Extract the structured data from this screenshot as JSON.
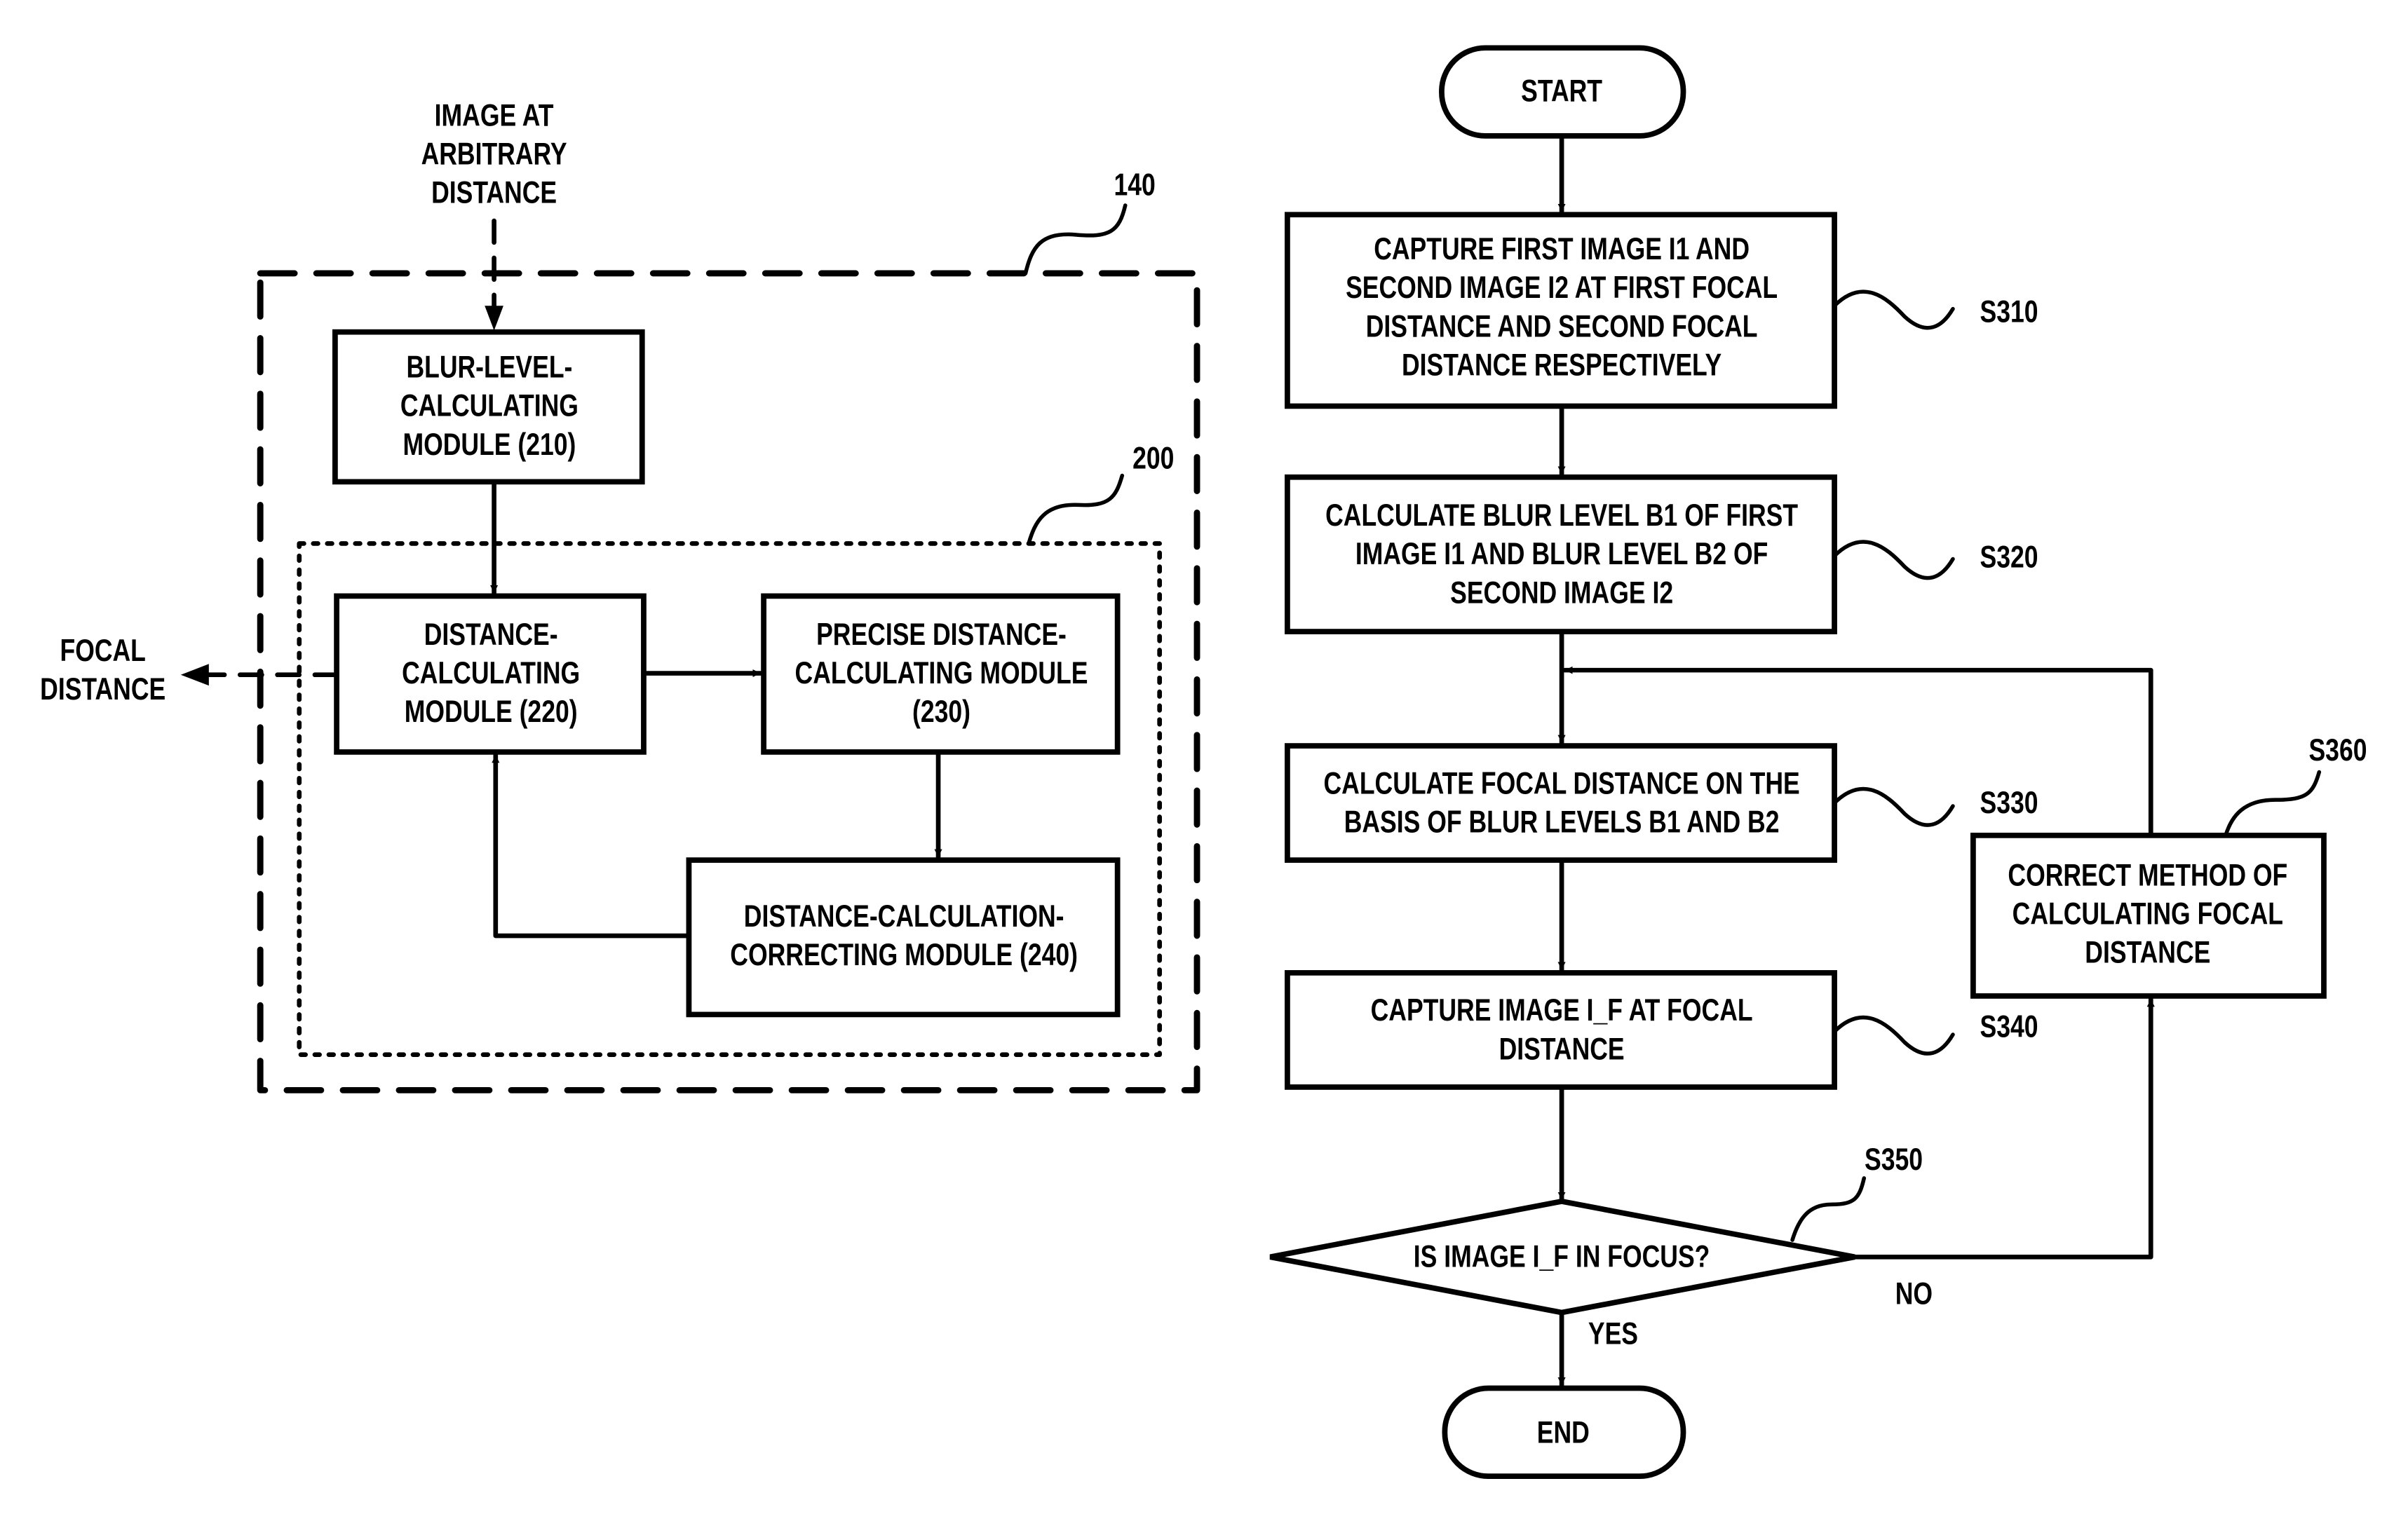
{
  "figure": {
    "left_diagram": {
      "input_label": [
        "IMAGE AT",
        "ARBITRARY",
        "DISTANCE"
      ],
      "output_label": [
        "FOCAL",
        "DISTANCE"
      ],
      "outer_ref": "140",
      "inner_ref": "200",
      "modules": [
        {
          "id": "210",
          "lines": [
            "BLUR-LEVEL-",
            "CALCULATING",
            "MODULE (210)"
          ]
        },
        {
          "id": "220",
          "lines": [
            "DISTANCE-",
            "CALCULATING",
            "MODULE (220)"
          ]
        },
        {
          "id": "230",
          "lines": [
            "PRECISE DISTANCE-",
            "CALCULATING MODULE",
            "(230)"
          ]
        },
        {
          "id": "240",
          "lines": [
            "DISTANCE-CALCULATION-",
            "CORRECTING MODULE (240)"
          ]
        }
      ]
    },
    "flowchart": {
      "start": "START",
      "end": "END",
      "steps": [
        {
          "ref": "S310",
          "lines": [
            "CAPTURE FIRST IMAGE I1 AND",
            "SECOND IMAGE I2 AT FIRST FOCAL",
            "DISTANCE AND SECOND FOCAL",
            "DISTANCE RESPECTIVELY"
          ]
        },
        {
          "ref": "S320",
          "lines": [
            "CALCULATE BLUR LEVEL B1 OF FIRST",
            "IMAGE I1 AND BLUR LEVEL B2 OF",
            "SECOND IMAGE I2"
          ]
        },
        {
          "ref": "S330",
          "lines": [
            "CALCULATE FOCAL DISTANCE ON THE",
            "BASIS OF BLUR LEVELS B1 AND B2"
          ]
        },
        {
          "ref": "S340",
          "lines": [
            "CAPTURE IMAGE I_F AT FOCAL",
            "DISTANCE"
          ]
        }
      ],
      "decision": {
        "ref": "S350",
        "text": "IS IMAGE I_F IN FOCUS?",
        "yes_label": "YES",
        "no_label": "NO"
      },
      "correction": {
        "ref": "S360",
        "lines": [
          "CORRECT METHOD OF",
          "CALCULATING FOCAL",
          "DISTANCE"
        ]
      }
    }
  }
}
